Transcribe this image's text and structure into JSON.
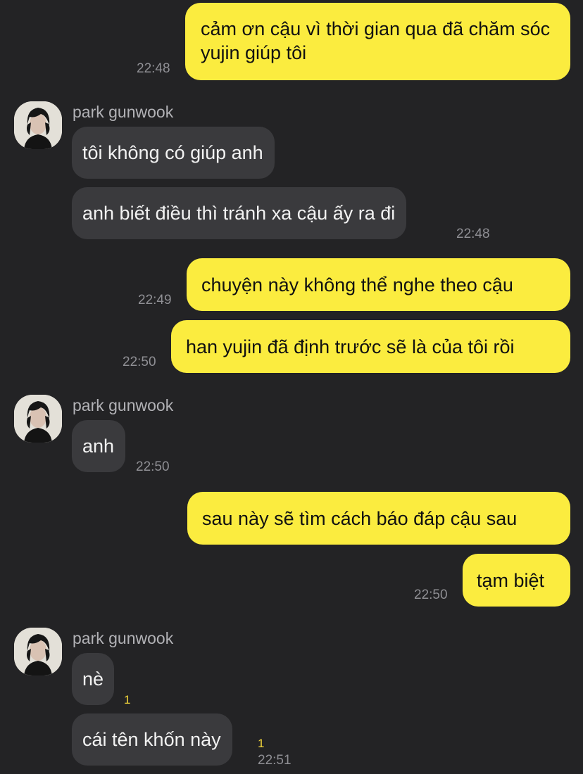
{
  "contact": {
    "name": "park gunwook"
  },
  "messages": [
    {
      "from": "me",
      "text": "cảm ơn cậu vì thời gian qua đã chăm sóc yujin giúp tôi",
      "time": "22:48"
    },
    {
      "from": "them",
      "text": "tôi không có giúp anh"
    },
    {
      "from": "them",
      "text": "anh biết điều thì tránh xa cậu ấy ra đi",
      "time": "22:48"
    },
    {
      "from": "me",
      "text": "chuyện này không thể nghe theo cậu",
      "time": "22:49"
    },
    {
      "from": "me",
      "text": "han yujin đã định trước sẽ là của tôi rồi",
      "time": "22:50"
    },
    {
      "from": "them",
      "text": "anh",
      "time": "22:50"
    },
    {
      "from": "me",
      "text": "sau này sẽ tìm cách báo đáp cậu sau"
    },
    {
      "from": "me",
      "text": "tạm biệt",
      "time": "22:50"
    },
    {
      "from": "them",
      "text": "nè",
      "unread": "1"
    },
    {
      "from": "them",
      "text": "cái tên khốn này",
      "unread": "1",
      "time": "22:51"
    }
  ],
  "colors": {
    "background": "#232325",
    "my_bubble": "#fbec3f",
    "their_bubble": "#3a3a3d",
    "unread_count": "#f3d63a"
  },
  "icons": {
    "avatar": "profile-photo"
  }
}
